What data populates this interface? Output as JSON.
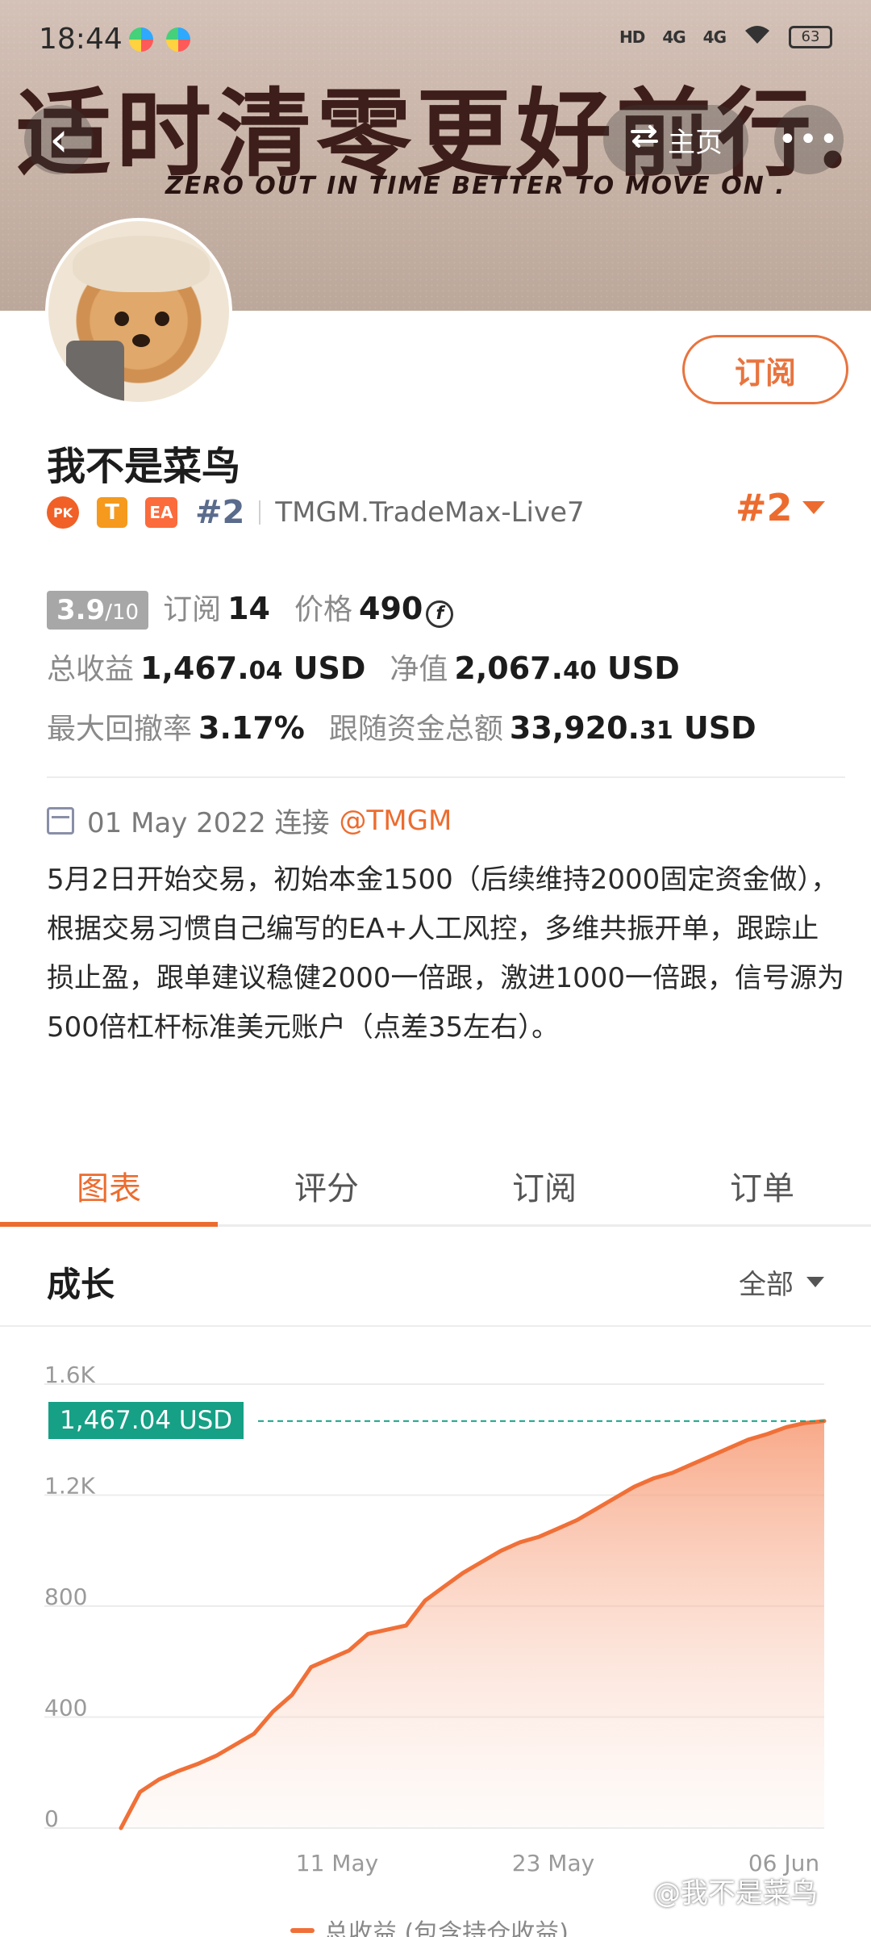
{
  "status": {
    "time": "18:44",
    "hd": "HD",
    "sig1": "4G",
    "sig2": "4G",
    "battery": "63"
  },
  "banner": {
    "title_cn": "适时清零更好前行.",
    "title_en": "ZERO OUT IN TIME BETTER TO MOVE ON ."
  },
  "nav": {
    "back_glyph": "‹",
    "home_label": "主页",
    "more_glyph": "•••"
  },
  "profile": {
    "name": "我不是菜鸟",
    "subscribe_label": "订阅",
    "badges": [
      "PK",
      "T",
      "EA"
    ],
    "rank": "#2",
    "server": "TMGM.TradeMax-Live7",
    "rank_big": "#2"
  },
  "stats": {
    "score": "3.9",
    "score_max": "/10",
    "subscribe_label": "订阅",
    "subscribe_count": "14",
    "price_label": "价格",
    "price_value": "490",
    "coin_glyph": "f",
    "total_profit_label": "总收益",
    "total_profit_main": "1,467.",
    "total_profit_dec": "04",
    "total_profit_unit": " USD",
    "equity_label": "净值",
    "equity_main": "2,067.",
    "equity_dec": "40",
    "equity_unit": " USD",
    "drawdown_label": "最大回撤率",
    "drawdown_value": "3.17%",
    "follow_label": "跟随资金总额",
    "follow_main": "33,920.",
    "follow_dec": "31",
    "follow_unit": " USD"
  },
  "connect": {
    "date": "01 May 2022 连接",
    "link": "@TMGM"
  },
  "description": "5月2日开始交易，初始本金1500（后续维持2000固定资金做），根据交易习惯自己编写的EA+人工风控，多维共振开单，跟踪止损止盈，跟单建议稳健2000一倍跟，激进1000一倍跟，信号源为500倍杠杆标准美元账户（点差35左右）。",
  "tabs": [
    "图表",
    "评分",
    "订阅",
    "订单"
  ],
  "section": {
    "title": "成长",
    "filter": "全部"
  },
  "chart_data": {
    "type": "area",
    "title": "成长",
    "y_ticks": [
      "1.6K",
      "1.2K",
      "800",
      "400",
      "0"
    ],
    "ylim": [
      0,
      1600
    ],
    "x_ticks": [
      "11 May",
      "23 May",
      "06 Jun"
    ],
    "current_value_label": "1,467.04 USD",
    "series": [
      {
        "name": "总收益 (包含持仓收益)",
        "values": [
          0,
          130,
          175,
          205,
          230,
          260,
          300,
          340,
          420,
          480,
          580,
          610,
          640,
          700,
          715,
          730,
          820,
          870,
          920,
          960,
          1000,
          1030,
          1050,
          1080,
          1110,
          1150,
          1190,
          1230,
          1260,
          1280,
          1310,
          1340,
          1370,
          1400,
          1420,
          1445,
          1460,
          1467
        ]
      }
    ],
    "grid": true,
    "line_color": "#f07038"
  },
  "legend_label": "总收益 (包含持仓收益)",
  "watermark": "@我不是菜鸟"
}
